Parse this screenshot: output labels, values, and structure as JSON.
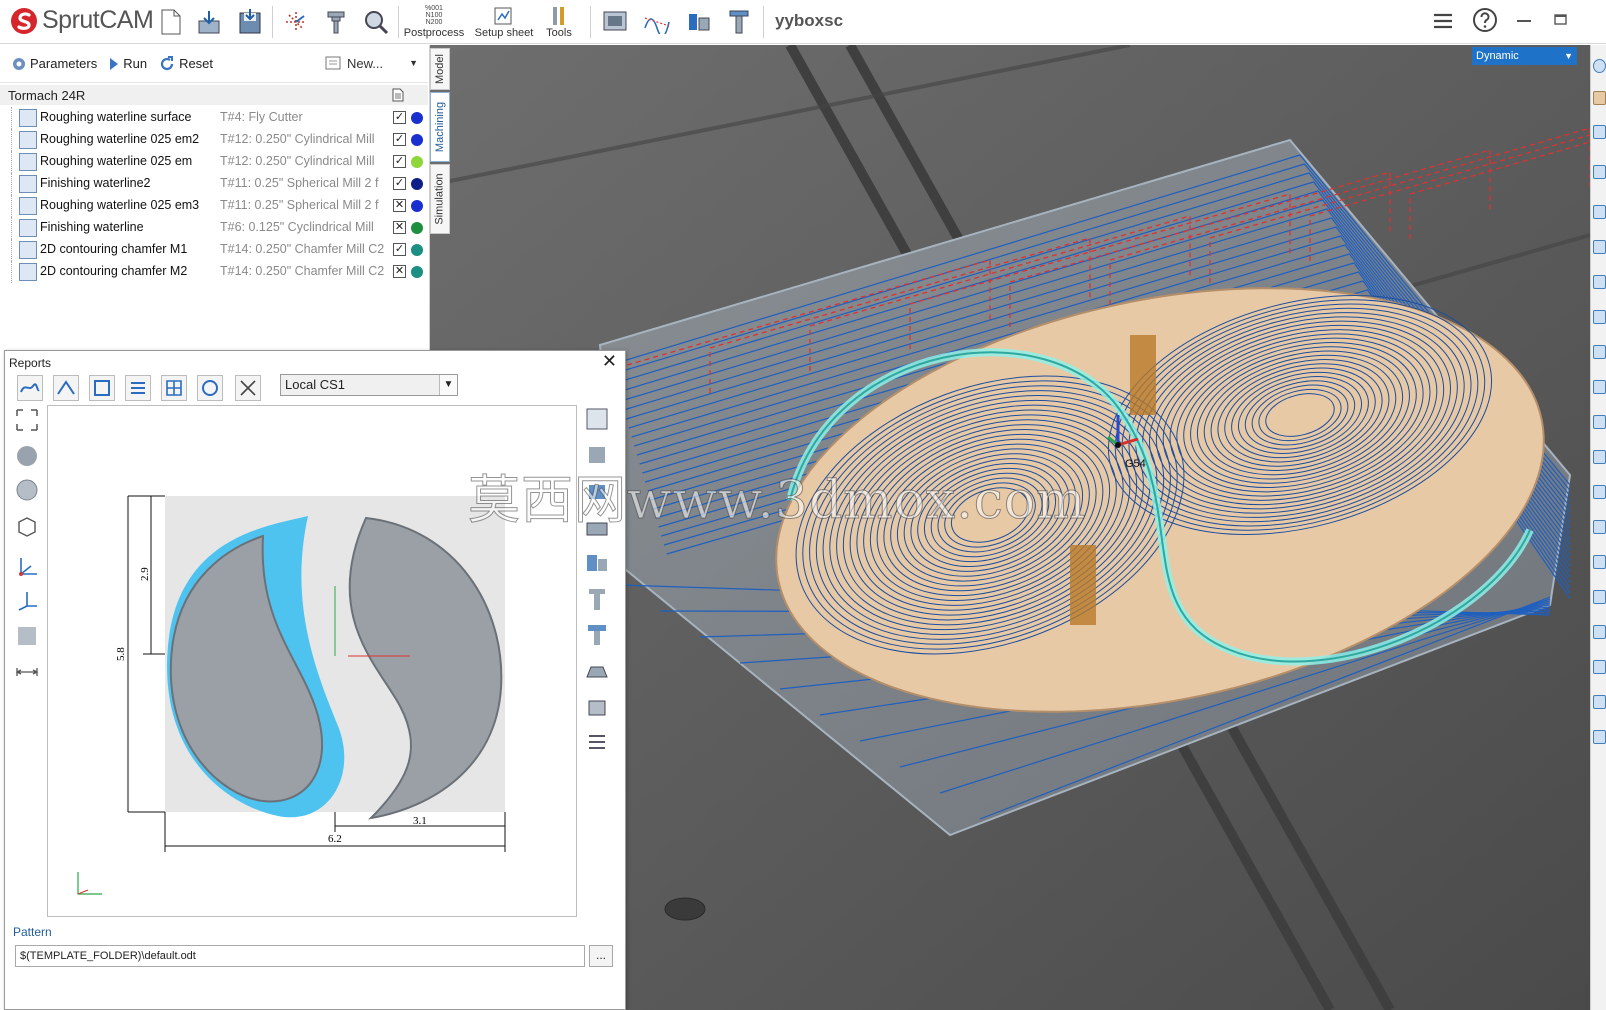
{
  "app": {
    "name": "SprutCAM",
    "project": "yyboxsc"
  },
  "toolbar": {
    "postprocess_label": "Postprocess",
    "postprocess_codes": [
      "%001",
      "N100",
      "N200"
    ],
    "setup_sheet_label": "Setup sheet",
    "tools_label": "Tools"
  },
  "operations_bar": {
    "parameters": "Parameters",
    "run": "Run",
    "reset": "Reset",
    "new": "New..."
  },
  "machine": "Tormach 24R",
  "operations": [
    {
      "name": "Roughing waterline surface",
      "tool": "T#4: Fly Cutter",
      "checked": true,
      "color": "#1a2fd0"
    },
    {
      "name": "Roughing waterline 025 em2",
      "tool": "T#12: 0.250\" Cylindrical Mill",
      "checked": true,
      "color": "#1a2fd0"
    },
    {
      "name": "Roughing waterline 025 em",
      "tool": "T#12: 0.250\" Cylindrical Mill",
      "checked": true,
      "color": "#8fd63a"
    },
    {
      "name": "Finishing waterline2",
      "tool": "T#11: 0.25\" Spherical Mill 2 f",
      "checked": true,
      "color": "#0e1f8a"
    },
    {
      "name": "Roughing waterline 025 em3",
      "tool": "T#11: 0.25\" Spherical Mill 2 f",
      "checked": false,
      "color": "#1a2fd0"
    },
    {
      "name": "Finishing waterline",
      "tool": "T#6: 0.125\" Cyclindrical Mill",
      "checked": false,
      "color": "#1e8f3e"
    },
    {
      "name": "2D contouring chamfer M1",
      "tool": "T#14: 0.250\" Chamfer Mill C2",
      "checked": true,
      "color": "#1a8f82"
    },
    {
      "name": "2D contouring chamfer M2",
      "tool": "T#14: 0.250\" Chamfer Mill C2",
      "checked": false,
      "color": "#1a8f82"
    }
  ],
  "side_tabs": {
    "model": "Model",
    "machining": "Machining",
    "simulation": "Simulation"
  },
  "viewport": {
    "mode": "Dynamic",
    "cs_label": "G54"
  },
  "reports": {
    "title": "Reports",
    "coordinate_system": "Local CS1",
    "dimensions": {
      "d1": "2.9",
      "d2": "5.8",
      "d3": "3.1",
      "d4": "6.2"
    },
    "pattern_label": "Pattern",
    "pattern_value": "$(TEMPLATE_FOLDER)\\default.odt",
    "browse": "..."
  },
  "watermark": "莫西网www.3dmox.com",
  "colors": {
    "accent": "#1e73c8",
    "toolpath": "#1f5fbf",
    "rapid": "#e03030",
    "part": "#e8c9a6"
  }
}
